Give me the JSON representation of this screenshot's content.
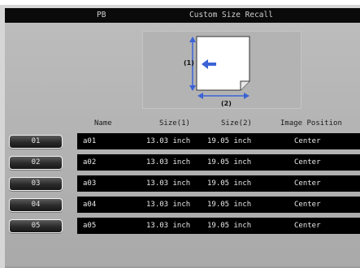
{
  "header": {
    "left": "PB",
    "title": "Custom Size Recall"
  },
  "diagram": {
    "label1": "(1)",
    "label2": "(2)"
  },
  "columns": {
    "name": "Name",
    "size1": "Size(1)",
    "size2": "Size(2)",
    "position": "Image Position"
  },
  "rows": [
    {
      "num": "01",
      "name": "a01",
      "size1": "13.03 inch",
      "size2": "19.05 inch",
      "position": "Center"
    },
    {
      "num": "02",
      "name": "a02",
      "size1": "13.03 inch",
      "size2": "19.05 inch",
      "position": "Center"
    },
    {
      "num": "03",
      "name": "a03",
      "size1": "13.03 inch",
      "size2": "19.05 inch",
      "position": "Center"
    },
    {
      "num": "04",
      "name": "a04",
      "size1": "13.03 inch",
      "size2": "19.05 inch",
      "position": "Center"
    },
    {
      "num": "05",
      "name": "a05",
      "size1": "13.03 inch",
      "size2": "19.05 inch",
      "position": "Center"
    }
  ]
}
